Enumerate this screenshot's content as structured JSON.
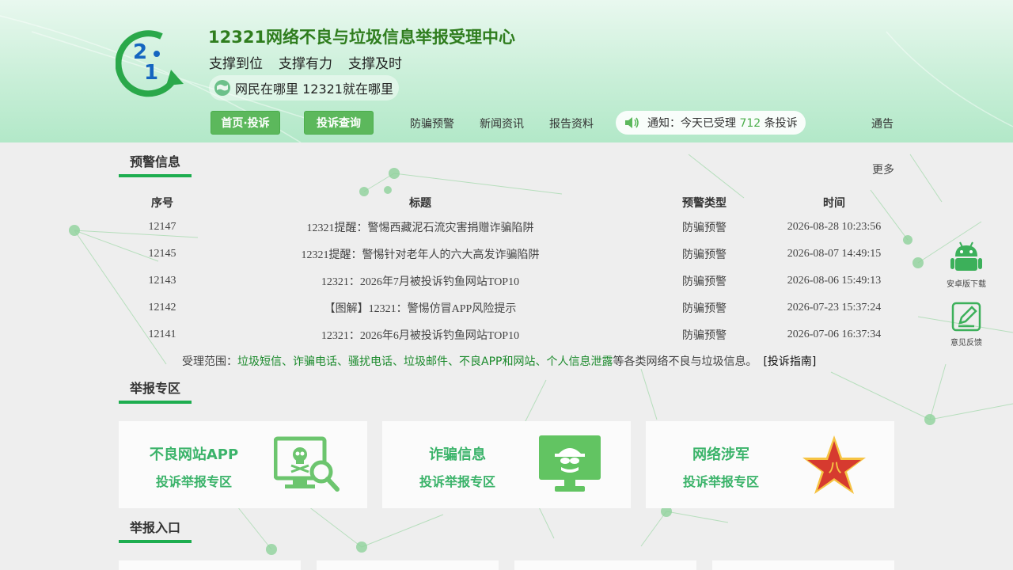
{
  "header": {
    "title": "12321网络不良与垃圾信息举报受理中心",
    "slogans": [
      "支撑到位",
      "支撑有力",
      "支撑及时"
    ],
    "motto": "网民在哪里 12321就在哪里"
  },
  "nav": {
    "btn_home": "首页·投诉",
    "btn_query": "投诉查询",
    "links": [
      "防骗预警",
      "新闻资讯",
      "报告资料"
    ],
    "notice_prefix": "通知：今天已受理",
    "notice_count": "712",
    "notice_suffix": "条投诉",
    "announce": "通告"
  },
  "alerts": {
    "title": "预警信息",
    "more": "更多",
    "headers": [
      "序号",
      "标题",
      "预警类型",
      "时间"
    ],
    "rows": [
      {
        "id": "12147",
        "title": "12321提醒：警惕西藏泥石流灾害捐赠诈骗陷阱",
        "type": "防骗预警",
        "time": "2026-08-28 10:23:56"
      },
      {
        "id": "12145",
        "title": "12321提醒：警惕针对老年人的六大高发诈骗陷阱",
        "type": "防骗预警",
        "time": "2026-08-07 14:49:15"
      },
      {
        "id": "12143",
        "title": "12321：2026年7月被投诉钓鱼网站TOP10",
        "type": "防骗预警",
        "time": "2026-08-06 15:49:13"
      },
      {
        "id": "12142",
        "title": "【图解】12321：警惕仿冒APP风险提示",
        "type": "防骗预警",
        "time": "2026-07-23 15:37:24"
      },
      {
        "id": "12141",
        "title": "12321：2026年6月被投诉钓鱼网站TOP10",
        "type": "防骗预警",
        "time": "2026-07-06 16:37:34"
      }
    ]
  },
  "scope": {
    "prefix": "受理范围：",
    "items": "垃圾短信、诈骗电话、骚扰电话、垃圾邮件、不良APP和网站、个人信息泄露",
    "suffix": "等各类网络不良与垃圾信息。",
    "guide": "[投诉指南]"
  },
  "report_zone": {
    "title": "举报专区",
    "cards": [
      {
        "title": "不良网站APP",
        "sub": "投诉举报专区"
      },
      {
        "title": "诈骗信息",
        "sub": "投诉举报专区"
      },
      {
        "title": "网络涉军",
        "sub": "投诉举报专区"
      }
    ]
  },
  "report_entry": {
    "title": "举报入口"
  },
  "float": {
    "android": "安卓版下载",
    "feedback": "意见反馈"
  },
  "colors": {
    "brand_green": "#1dad4f",
    "button_green": "#5cb85c",
    "title_green": "#2f7d1e",
    "card_green": "#3bb36a"
  }
}
